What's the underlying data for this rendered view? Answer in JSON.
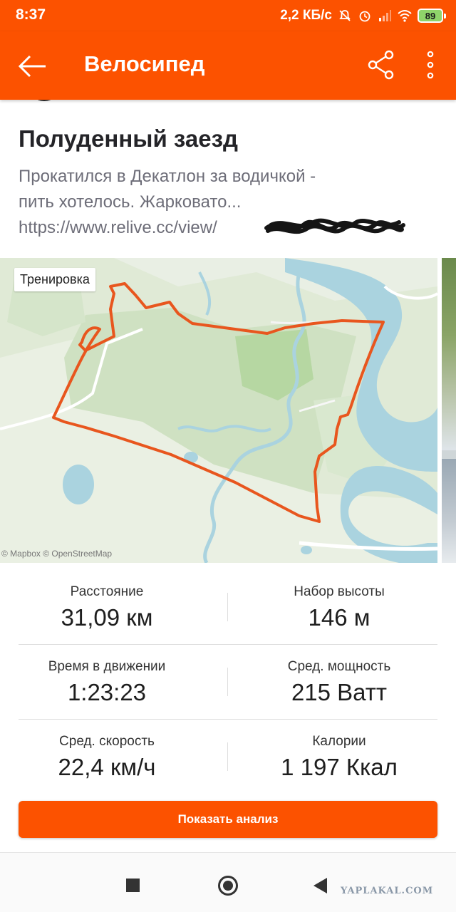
{
  "status_bar": {
    "time": "8:37",
    "network_speed": "2,2 КБ/с",
    "battery": "89",
    "icons": [
      "mute-icon",
      "alarm-icon",
      "signal-icon",
      "wifi-icon",
      "battery-icon"
    ]
  },
  "app_bar": {
    "title": "Велосипед",
    "back_icon": "arrow-left-icon",
    "share_icon": "share-icon",
    "more_icon": "more-vert-icon",
    "accent_color": "#fc5200"
  },
  "activity": {
    "title": "Полуденный заезд",
    "description_lines": [
      "Прокатился в Декатлон за водичкой -",
      "пить хотелось. Жарковато...",
      "https://www.relive.cc/view/"
    ]
  },
  "map": {
    "tag": "Тренировка",
    "attribution": "© Mapbox © OpenStreetMap",
    "route_color": "#e8561e"
  },
  "stats": [
    {
      "label": "Расстояние",
      "value": "31,09 км"
    },
    {
      "label": "Набор высоты",
      "value": "146 м"
    },
    {
      "label": "Время в движении",
      "value": "1:23:23"
    },
    {
      "label": "Сред. мощность",
      "value": "215 Ватт"
    },
    {
      "label": "Сред. скорость",
      "value": "22,4 км/ч"
    },
    {
      "label": "Калории",
      "value": "1 197 Ккал"
    }
  ],
  "analysis_button": {
    "label": "Показать анализ"
  },
  "nav_bar": {
    "icons": [
      "recent-apps-icon",
      "home-icon",
      "back-triangle-icon"
    ]
  },
  "watermark": "YAPLAKAL.COM"
}
